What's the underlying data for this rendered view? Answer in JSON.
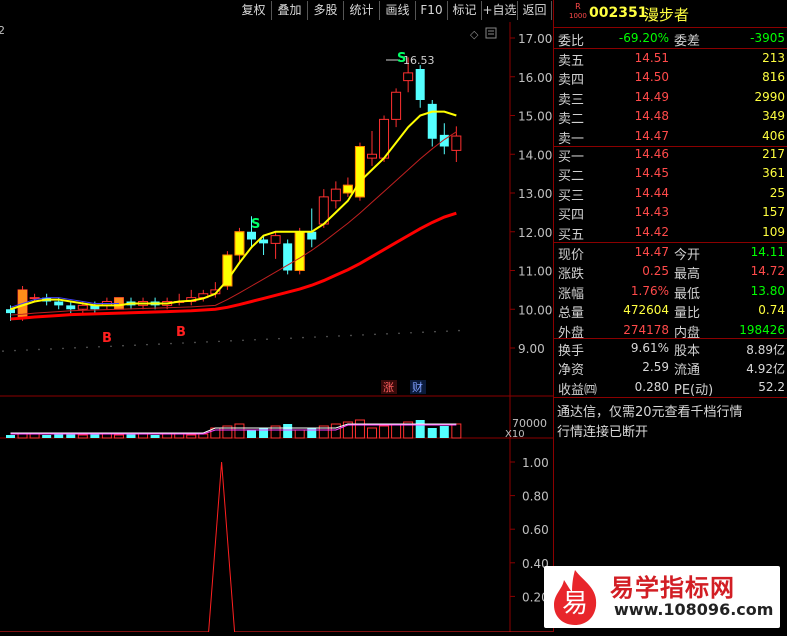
{
  "toolbar": {
    "buttons": [
      "复权",
      "叠加",
      "多股",
      "统计",
      "画线",
      "F10",
      "标记",
      "+自选",
      "返回"
    ]
  },
  "stock": {
    "market_badge_top": "R",
    "market_badge_bottom": "1000",
    "code": "002351",
    "name": "漫步者"
  },
  "weibi": {
    "label1": "委比",
    "value1": "-69.20%",
    "label2": "委差",
    "value2": "-3905"
  },
  "sell": [
    {
      "label": "卖五",
      "price": "14.51",
      "vol": "213"
    },
    {
      "label": "卖四",
      "price": "14.50",
      "vol": "816"
    },
    {
      "label": "卖三",
      "price": "14.49",
      "vol": "2990"
    },
    {
      "label": "卖二",
      "price": "14.48",
      "vol": "349"
    },
    {
      "label": "卖一",
      "price": "14.47",
      "vol": "406"
    }
  ],
  "buy": [
    {
      "label": "买一",
      "price": "14.46",
      "vol": "217"
    },
    {
      "label": "买二",
      "price": "14.45",
      "vol": "361"
    },
    {
      "label": "买三",
      "price": "14.44",
      "vol": "25"
    },
    {
      "label": "买四",
      "price": "14.43",
      "vol": "157"
    },
    {
      "label": "买五",
      "price": "14.42",
      "vol": "109"
    }
  ],
  "quote": [
    {
      "l1": "现价",
      "v1": "14.47",
      "l2": "今开",
      "v2": "14.11"
    },
    {
      "l1": "涨跌",
      "v1": "0.25",
      "l2": "最高",
      "v2": "14.72"
    },
    {
      "l1": "涨幅",
      "v1": "1.76%",
      "l2": "最低",
      "v2": "13.80"
    },
    {
      "l1": "总量",
      "v1": "472604",
      "l2": "量比",
      "v2": "0.74"
    },
    {
      "l1": "外盘",
      "v1": "274178",
      "l2": "内盘",
      "v2": "198426"
    }
  ],
  "fund": [
    {
      "l1": "换手",
      "v1": "9.61%",
      "l2": "股本",
      "v2": "8.89亿"
    },
    {
      "l1": "净资",
      "v1": "2.59",
      "l2": "流通",
      "v2": "4.92亿"
    },
    {
      "l1": "收益㈣",
      "v1": "0.280",
      "l2": "PE(动)",
      "v2": "52.2"
    }
  ],
  "messages": [
    "通达信，仅需20元查看千档行情",
    "行情连接已断开"
  ],
  "watermark": {
    "name": "易学指标网",
    "url": "www.108096.com",
    "logo_char": "易"
  },
  "chart": {
    "top_left_label": "2",
    "price_axis": [
      "17.00",
      "16.00",
      "15.00",
      "14.00",
      "13.00",
      "12.00",
      "11.00",
      "10.00",
      "9.00"
    ],
    "high_label": "16.53",
    "signals": [
      "S",
      "S",
      "B",
      "B"
    ],
    "news_tags": [
      "涨",
      "财"
    ],
    "volume_axis_label": "70000",
    "volume_unit": "X10",
    "indicator_axis": [
      "1.00",
      "0.80",
      "0.60",
      "0.40",
      "0.20"
    ],
    "colors": {
      "up": "#ff3030",
      "down": "#54ffff",
      "ma5": "#ffff00",
      "ma_long": "#ff0000",
      "grid": "#8b0000"
    }
  },
  "chart_data": {
    "type": "candlestick",
    "price_range": [
      8.8,
      17.3
    ],
    "candles": [
      {
        "o": 10.0,
        "c": 9.9,
        "h": 10.1,
        "l": 9.7
      },
      {
        "o": 9.8,
        "c": 10.5,
        "h": 10.6,
        "l": 9.7
      },
      {
        "o": 10.3,
        "c": 10.3,
        "h": 10.4,
        "l": 10.2
      },
      {
        "o": 10.3,
        "c": 10.2,
        "h": 10.4,
        "l": 10.1
      },
      {
        "o": 10.2,
        "c": 10.1,
        "h": 10.3,
        "l": 10.0
      },
      {
        "o": 10.1,
        "c": 10.0,
        "h": 10.2,
        "l": 9.9
      },
      {
        "o": 10.0,
        "c": 10.1,
        "h": 10.2,
        "l": 9.9
      },
      {
        "o": 10.1,
        "c": 10.0,
        "h": 10.2,
        "l": 9.9
      },
      {
        "o": 10.1,
        "c": 10.2,
        "h": 10.3,
        "l": 10.0
      },
      {
        "o": 10.0,
        "c": 10.3,
        "h": 10.3,
        "l": 10.0
      },
      {
        "o": 10.2,
        "c": 10.1,
        "h": 10.3,
        "l": 10.0
      },
      {
        "o": 10.1,
        "c": 10.2,
        "h": 10.3,
        "l": 10.0
      },
      {
        "o": 10.2,
        "c": 10.1,
        "h": 10.3,
        "l": 10.0
      },
      {
        "o": 10.1,
        "c": 10.2,
        "h": 10.3,
        "l": 10.0
      },
      {
        "o": 10.2,
        "c": 10.2,
        "h": 10.4,
        "l": 10.1
      },
      {
        "o": 10.2,
        "c": 10.3,
        "h": 10.5,
        "l": 10.1
      },
      {
        "o": 10.3,
        "c": 10.4,
        "h": 10.5,
        "l": 10.2
      },
      {
        "o": 10.4,
        "c": 10.5,
        "h": 10.7,
        "l": 10.3
      },
      {
        "o": 10.6,
        "c": 11.4,
        "h": 11.5,
        "l": 10.5
      },
      {
        "o": 11.4,
        "c": 12.0,
        "h": 12.1,
        "l": 11.2
      },
      {
        "o": 12.0,
        "c": 11.8,
        "h": 12.4,
        "l": 11.6
      },
      {
        "o": 11.8,
        "c": 11.7,
        "h": 11.9,
        "l": 11.4
      },
      {
        "o": 11.7,
        "c": 11.9,
        "h": 12.0,
        "l": 11.3
      },
      {
        "o": 11.7,
        "c": 11.0,
        "h": 11.8,
        "l": 10.9
      },
      {
        "o": 11.0,
        "c": 12.0,
        "h": 12.1,
        "l": 10.9
      },
      {
        "o": 12.0,
        "c": 11.8,
        "h": 12.6,
        "l": 11.6
      },
      {
        "o": 12.2,
        "c": 12.9,
        "h": 13.1,
        "l": 12.1
      },
      {
        "o": 12.8,
        "c": 13.1,
        "h": 13.3,
        "l": 12.6
      },
      {
        "o": 13.0,
        "c": 13.2,
        "h": 13.4,
        "l": 12.9
      },
      {
        "o": 12.9,
        "c": 14.2,
        "h": 14.3,
        "l": 12.8
      },
      {
        "o": 13.9,
        "c": 14.0,
        "h": 14.6,
        "l": 13.7
      },
      {
        "o": 13.9,
        "c": 14.9,
        "h": 15.0,
        "l": 13.8
      },
      {
        "o": 14.9,
        "c": 15.6,
        "h": 15.7,
        "l": 14.7
      },
      {
        "o": 15.9,
        "c": 16.1,
        "h": 16.5,
        "l": 15.6
      },
      {
        "o": 16.2,
        "c": 15.4,
        "h": 16.3,
        "l": 15.2
      },
      {
        "o": 15.3,
        "c": 14.4,
        "h": 15.4,
        "l": 14.2
      },
      {
        "o": 14.5,
        "c": 14.2,
        "h": 14.8,
        "l": 14.0
      },
      {
        "o": 14.1,
        "c": 14.47,
        "h": 14.72,
        "l": 13.8
      }
    ],
    "ma5": [
      10.0,
      10.1,
      10.2,
      10.25,
      10.25,
      10.2,
      10.15,
      10.1,
      10.1,
      10.1,
      10.15,
      10.15,
      10.15,
      10.15,
      10.2,
      10.22,
      10.28,
      10.4,
      10.75,
      11.2,
      11.6,
      11.9,
      12.0,
      12.0,
      12.0,
      12.0,
      12.2,
      12.5,
      12.8,
      13.3,
      13.6,
      13.9,
      14.3,
      14.7,
      15.0,
      15.1,
      15.1,
      15.0
    ],
    "ma_long": [
      9.75,
      9.77,
      9.8,
      9.82,
      9.84,
      9.86,
      9.87,
      9.88,
      9.89,
      9.9,
      9.91,
      9.92,
      9.93,
      9.94,
      9.95,
      9.96,
      9.98,
      10.0,
      10.05,
      10.12,
      10.2,
      10.28,
      10.36,
      10.44,
      10.52,
      10.62,
      10.74,
      10.88,
      11.02,
      11.18,
      11.36,
      11.54,
      11.72,
      11.9,
      12.08,
      12.24,
      12.38,
      12.48
    ],
    "indicator": {
      "range": [
        0,
        1.1
      ],
      "peak_index": 22,
      "peak_value": 1.0
    }
  }
}
